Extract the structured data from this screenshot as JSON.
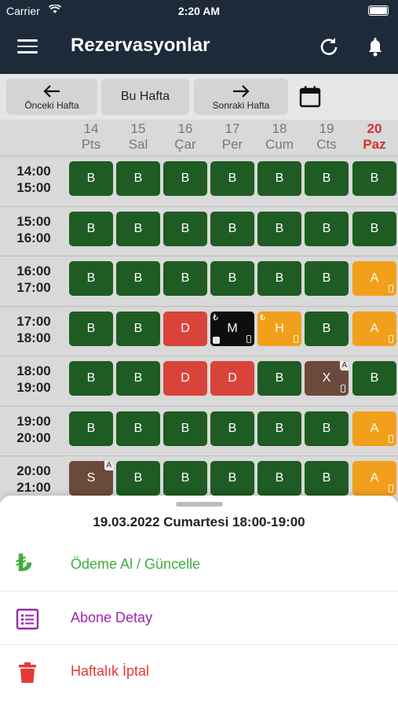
{
  "statusbar": {
    "carrier": "Carrier",
    "time": "2:20 AM"
  },
  "navbar": {
    "title": "Rezervasyonlar"
  },
  "weeknav": {
    "prev": "Önceki Hafta",
    "current": "Bu Hafta",
    "next": "Sonraki Hafta"
  },
  "days": [
    {
      "num": "14",
      "name": "Pts"
    },
    {
      "num": "15",
      "name": "Sal"
    },
    {
      "num": "16",
      "name": "Çar"
    },
    {
      "num": "17",
      "name": "Per"
    },
    {
      "num": "18",
      "name": "Cum"
    },
    {
      "num": "19",
      "name": "Cts"
    },
    {
      "num": "20",
      "name": "Paz"
    }
  ],
  "colors": {
    "green": "#1e5c23",
    "red": "#d9443a",
    "orange": "#f2a01b",
    "black": "#0e0e0e",
    "brown": "#6b4a3c",
    "navy": "#1d2a3a"
  },
  "rows": [
    {
      "start": "14:00",
      "end": "15:00",
      "slots": [
        "B",
        "B",
        "B",
        "B",
        "B",
        "B",
        "B"
      ]
    },
    {
      "start": "15:00",
      "end": "16:00",
      "slots": [
        "B",
        "B",
        "B",
        "B",
        "B",
        "B",
        "B"
      ]
    },
    {
      "start": "16:00",
      "end": "17:00",
      "slots": [
        "B",
        "B",
        "B",
        "B",
        "B",
        "B",
        "A"
      ]
    },
    {
      "start": "17:00",
      "end": "18:00",
      "slots": [
        "B",
        "B",
        "D",
        "M",
        "H",
        "B",
        "A"
      ]
    },
    {
      "start": "18:00",
      "end": "19:00",
      "slots": [
        "B",
        "B",
        "D",
        "D",
        "B",
        "X",
        "B"
      ]
    },
    {
      "start": "19:00",
      "end": "20:00",
      "slots": [
        "B",
        "B",
        "B",
        "B",
        "B",
        "B",
        "A"
      ]
    },
    {
      "start": "20:00",
      "end": "21:00",
      "slots": [
        "S",
        "B",
        "B",
        "B",
        "B",
        "B",
        "A"
      ]
    }
  ],
  "slot_mark_a": "A",
  "lira_symbol": "₺",
  "sheet": {
    "title": "19.03.2022 Cumartesi 18:00-19:00",
    "actions": [
      {
        "label": "Ödeme Al / Güncelle",
        "icon": "lira-icon",
        "color": "#3fae3f"
      },
      {
        "label": "Abone Detay",
        "icon": "list-icon",
        "color": "#9c27b0"
      },
      {
        "label": "Haftalık İptal",
        "icon": "trash-icon",
        "color": "#e53935"
      }
    ]
  }
}
